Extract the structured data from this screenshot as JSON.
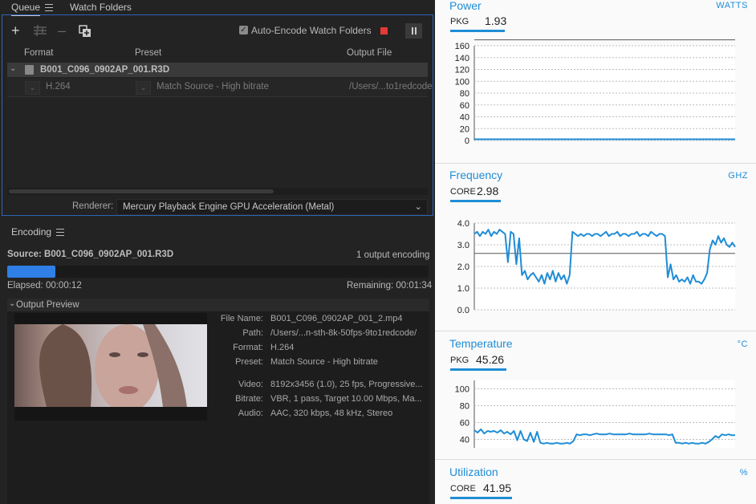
{
  "queue": {
    "tabs": [
      "Queue",
      "Watch Folders"
    ],
    "auto_encode_label": "Auto-Encode Watch Folders",
    "columns": [
      "Format",
      "Preset",
      "Output File"
    ],
    "source_row": {
      "name": "B001_C096_0902AP_001.R3D"
    },
    "output_row": {
      "format": "H.264",
      "preset": "Match Source - High bitrate",
      "output_file": "/Users/...to1redcode"
    },
    "renderer_label": "Renderer:",
    "renderer_value": "Mercury Playback Engine GPU Acceleration (Metal)"
  },
  "encoding": {
    "title": "Encoding",
    "source": "Source: B001_C096_0902AP_001.R3D",
    "output_count": "1 output encoding",
    "progress": 0.115,
    "elapsed": "Elapsed: 00:00:12",
    "remaining": "Remaining: 00:01:34",
    "preview_title": "Output Preview",
    "meta": [
      {
        "label": "File Name:",
        "value": "B001_C096_0902AP_001_2.mp4"
      },
      {
        "label": "Path:",
        "value": "/Users/...n-sth-8k-50fps-9to1redcode/"
      },
      {
        "label": "Format:",
        "value": "H.264"
      },
      {
        "label": "Preset:",
        "value": "Match Source - High bitrate"
      },
      {
        "label": "Video:",
        "value": "8192x3456 (1.0), 25 fps, Progressive..."
      },
      {
        "label": "Bitrate:",
        "value": "VBR, 1 pass, Target 10.00 Mbps, Ma..."
      },
      {
        "label": "Audio:",
        "value": "AAC, 320 kbps, 48 kHz, Stereo"
      }
    ]
  },
  "istat": {
    "power": {
      "title": "Power",
      "unit": "WATTS",
      "sub_label": "PKG",
      "value": "1.93"
    },
    "frequency": {
      "title": "Frequency",
      "unit": "GHZ",
      "sub_label": "CORE",
      "value": "2.98"
    },
    "temperature": {
      "title": "Temperature",
      "unit": "°C",
      "sub_label": "PKG",
      "value": "45.26"
    },
    "utilization": {
      "title": "Utilization",
      "unit": "%",
      "sub_label": "CORE",
      "value": "41.95"
    }
  },
  "colors": {
    "accent": "#1f8dd6",
    "progress": "#2f7fe6",
    "stop": "#e53935"
  },
  "chart_data": [
    {
      "type": "line",
      "title": "Power",
      "ylim": [
        0,
        160
      ],
      "yticks": [
        0,
        20,
        40,
        60,
        80,
        100,
        120,
        140,
        160
      ],
      "grid": true,
      "series": [
        {
          "values": [
            2,
            2,
            2,
            2,
            2,
            2,
            2,
            2,
            2,
            2,
            2,
            2,
            2,
            2,
            2,
            2,
            2,
            2,
            2,
            2,
            2,
            2,
            2,
            2,
            2,
            2,
            2,
            2,
            2,
            2,
            2,
            2,
            2,
            2,
            2,
            2,
            2,
            2,
            2,
            2
          ]
        }
      ],
      "reference_line": 170
    },
    {
      "type": "line",
      "title": "Frequency",
      "ylim": [
        0,
        4.0
      ],
      "yticks": [
        0.0,
        1.0,
        2.0,
        3.0,
        4.0
      ],
      "grid": true,
      "reference_line": 2.6,
      "series": [
        {
          "values": [
            3.5,
            3.6,
            3.4,
            3.6,
            3.5,
            3.7,
            3.4,
            3.6,
            3.5,
            3.7,
            3.6,
            3.5,
            2.2,
            3.6,
            3.5,
            2.1,
            3.3,
            1.6,
            1.8,
            1.4,
            1.6,
            1.7,
            1.5,
            1.3,
            1.6,
            1.2,
            1.7,
            1.4,
            1.8,
            1.3,
            1.7,
            1.4,
            1.6,
            1.2,
            1.6,
            3.6,
            3.5,
            3.4,
            3.5,
            3.4,
            3.5,
            3.5,
            3.4,
            3.5,
            3.5,
            3.4,
            3.5,
            3.6,
            3.4,
            3.5,
            3.5,
            3.6,
            3.4,
            3.5,
            3.5,
            3.4,
            3.5,
            3.5,
            3.6,
            3.4,
            3.5,
            3.5,
            3.4,
            3.6,
            3.5,
            3.4,
            3.5,
            3.5,
            3.4,
            1.5,
            2.1,
            1.4,
            1.6,
            1.3,
            1.4,
            1.3,
            1.5,
            1.2,
            1.6,
            1.3,
            1.3,
            1.2,
            1.4,
            1.7,
            2.8,
            3.2,
            3.0,
            3.4,
            3.1,
            3.3,
            3.0,
            2.9,
            3.1,
            2.9
          ]
        }
      ]
    },
    {
      "type": "line",
      "title": "Temperature",
      "ylim": [
        30,
        110
      ],
      "yticks": [
        40,
        60,
        80,
        100
      ],
      "grid": true,
      "series": [
        {
          "values": [
            51,
            48,
            52,
            47,
            50,
            49,
            50,
            48,
            51,
            47,
            49,
            46,
            50,
            39,
            50,
            40,
            38,
            48,
            37,
            49,
            36,
            35,
            36,
            35,
            35,
            36,
            35,
            35,
            36,
            35,
            38,
            46,
            45,
            46,
            46,
            45,
            46,
            47,
            46,
            46,
            46,
            47,
            46,
            46,
            46,
            46,
            46,
            47,
            46,
            46,
            46,
            46,
            46,
            47,
            46,
            46,
            46,
            46,
            46,
            45,
            46,
            36,
            36,
            35,
            36,
            35,
            36,
            35,
            35,
            36,
            35,
            37,
            40,
            44,
            42,
            46,
            45,
            46,
            45,
            45
          ]
        }
      ]
    }
  ]
}
